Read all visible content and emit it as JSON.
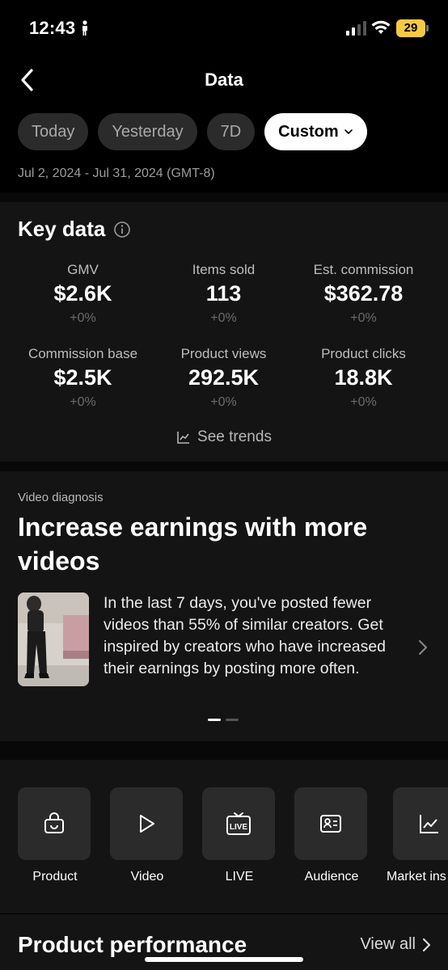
{
  "status": {
    "time": "12:43",
    "battery": "29"
  },
  "header": {
    "title": "Data"
  },
  "tabs": [
    {
      "label": "Today"
    },
    {
      "label": "Yesterday"
    },
    {
      "label": "7D"
    },
    {
      "label": "Custom"
    }
  ],
  "date_range": "Jul 2, 2024 - Jul 31, 2024 (GMT-8)",
  "key_data": {
    "title": "Key data",
    "metrics": [
      {
        "label": "GMV",
        "value": "$2.6K",
        "change": "+0%"
      },
      {
        "label": "Items sold",
        "value": "113",
        "change": "+0%"
      },
      {
        "label": "Est. commission",
        "value": "$362.78",
        "change": "+0%"
      },
      {
        "label": "Commission base",
        "value": "$2.5K",
        "change": "+0%"
      },
      {
        "label": "Product views",
        "value": "292.5K",
        "change": "+0%"
      },
      {
        "label": "Product clicks",
        "value": "18.8K",
        "change": "+0%"
      }
    ],
    "see_trends": "See trends"
  },
  "video_diagnosis": {
    "label": "Video diagnosis",
    "title": "Increase earnings with more videos",
    "body": "In the last 7 days, you've posted fewer videos than 55% of similar creators. Get inspired by creators who have increased their earnings by posting more often."
  },
  "tools": [
    {
      "label": "Product",
      "icon": "shopping-bag-icon"
    },
    {
      "label": "Video",
      "icon": "play-icon"
    },
    {
      "label": "LIVE",
      "icon": "live-tv-icon"
    },
    {
      "label": "Audience",
      "icon": "id-card-icon"
    },
    {
      "label": "Market ins",
      "icon": "line-chart-icon"
    }
  ],
  "product_performance": {
    "title": "Product performance",
    "view_all": "View all"
  },
  "colors": {
    "background": "#000000",
    "card": "#141414",
    "chip": "#2b2b2b",
    "battery": "#f6c945"
  }
}
